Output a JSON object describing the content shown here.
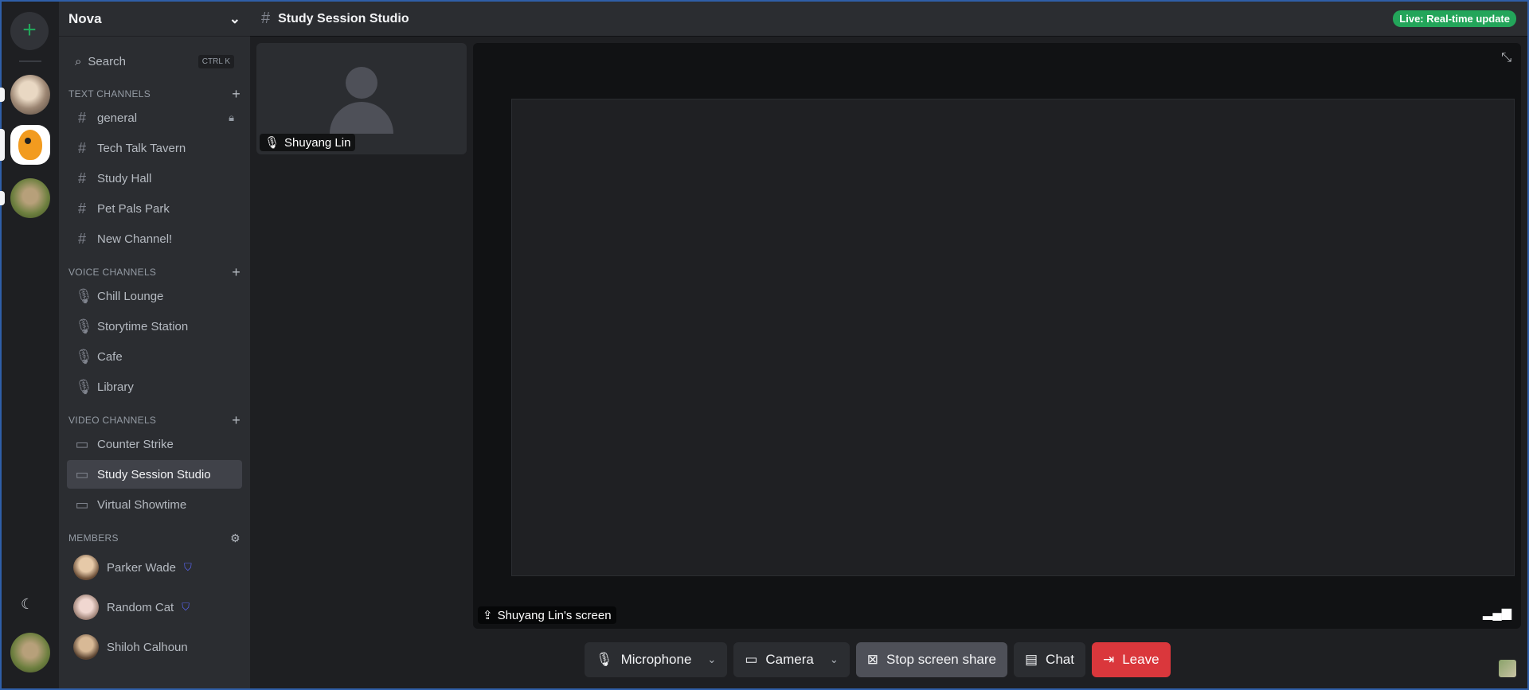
{
  "server": {
    "name": "Nova",
    "add_label": "+"
  },
  "search": {
    "placeholder": "Search",
    "shortcut": "CTRL K"
  },
  "sections": {
    "text": "TEXT CHANNELS",
    "voice": "VOICE CHANNELS",
    "video": "VIDEO CHANNELS",
    "members": "MEMBERS"
  },
  "text_channels": [
    "general",
    "Tech Talk Tavern",
    "Study Hall",
    "Pet Pals Park",
    "New Channel!"
  ],
  "voice_channels": [
    "Chill Lounge",
    "Storytime Station",
    "Cafe",
    "Library"
  ],
  "video_channels": [
    "Counter Strike",
    "Study Session Studio",
    "Virtual Showtime"
  ],
  "members": [
    "Parker Wade",
    "Random Cat",
    "Shiloh Calhoun"
  ],
  "header": {
    "channel": "Study Session Studio",
    "live_badge": "Live: Real-time update"
  },
  "stage": {
    "participant": "Shuyang Lin",
    "screen_label": "Shuyang Lin's screen"
  },
  "controls": {
    "microphone": "Microphone",
    "camera": "Camera",
    "stop_share": "Stop screen share",
    "chat": "Chat",
    "leave": "Leave"
  },
  "colors": {
    "accent_green": "#23a55a",
    "leave_red": "#da373c",
    "active_row": "#404249"
  }
}
